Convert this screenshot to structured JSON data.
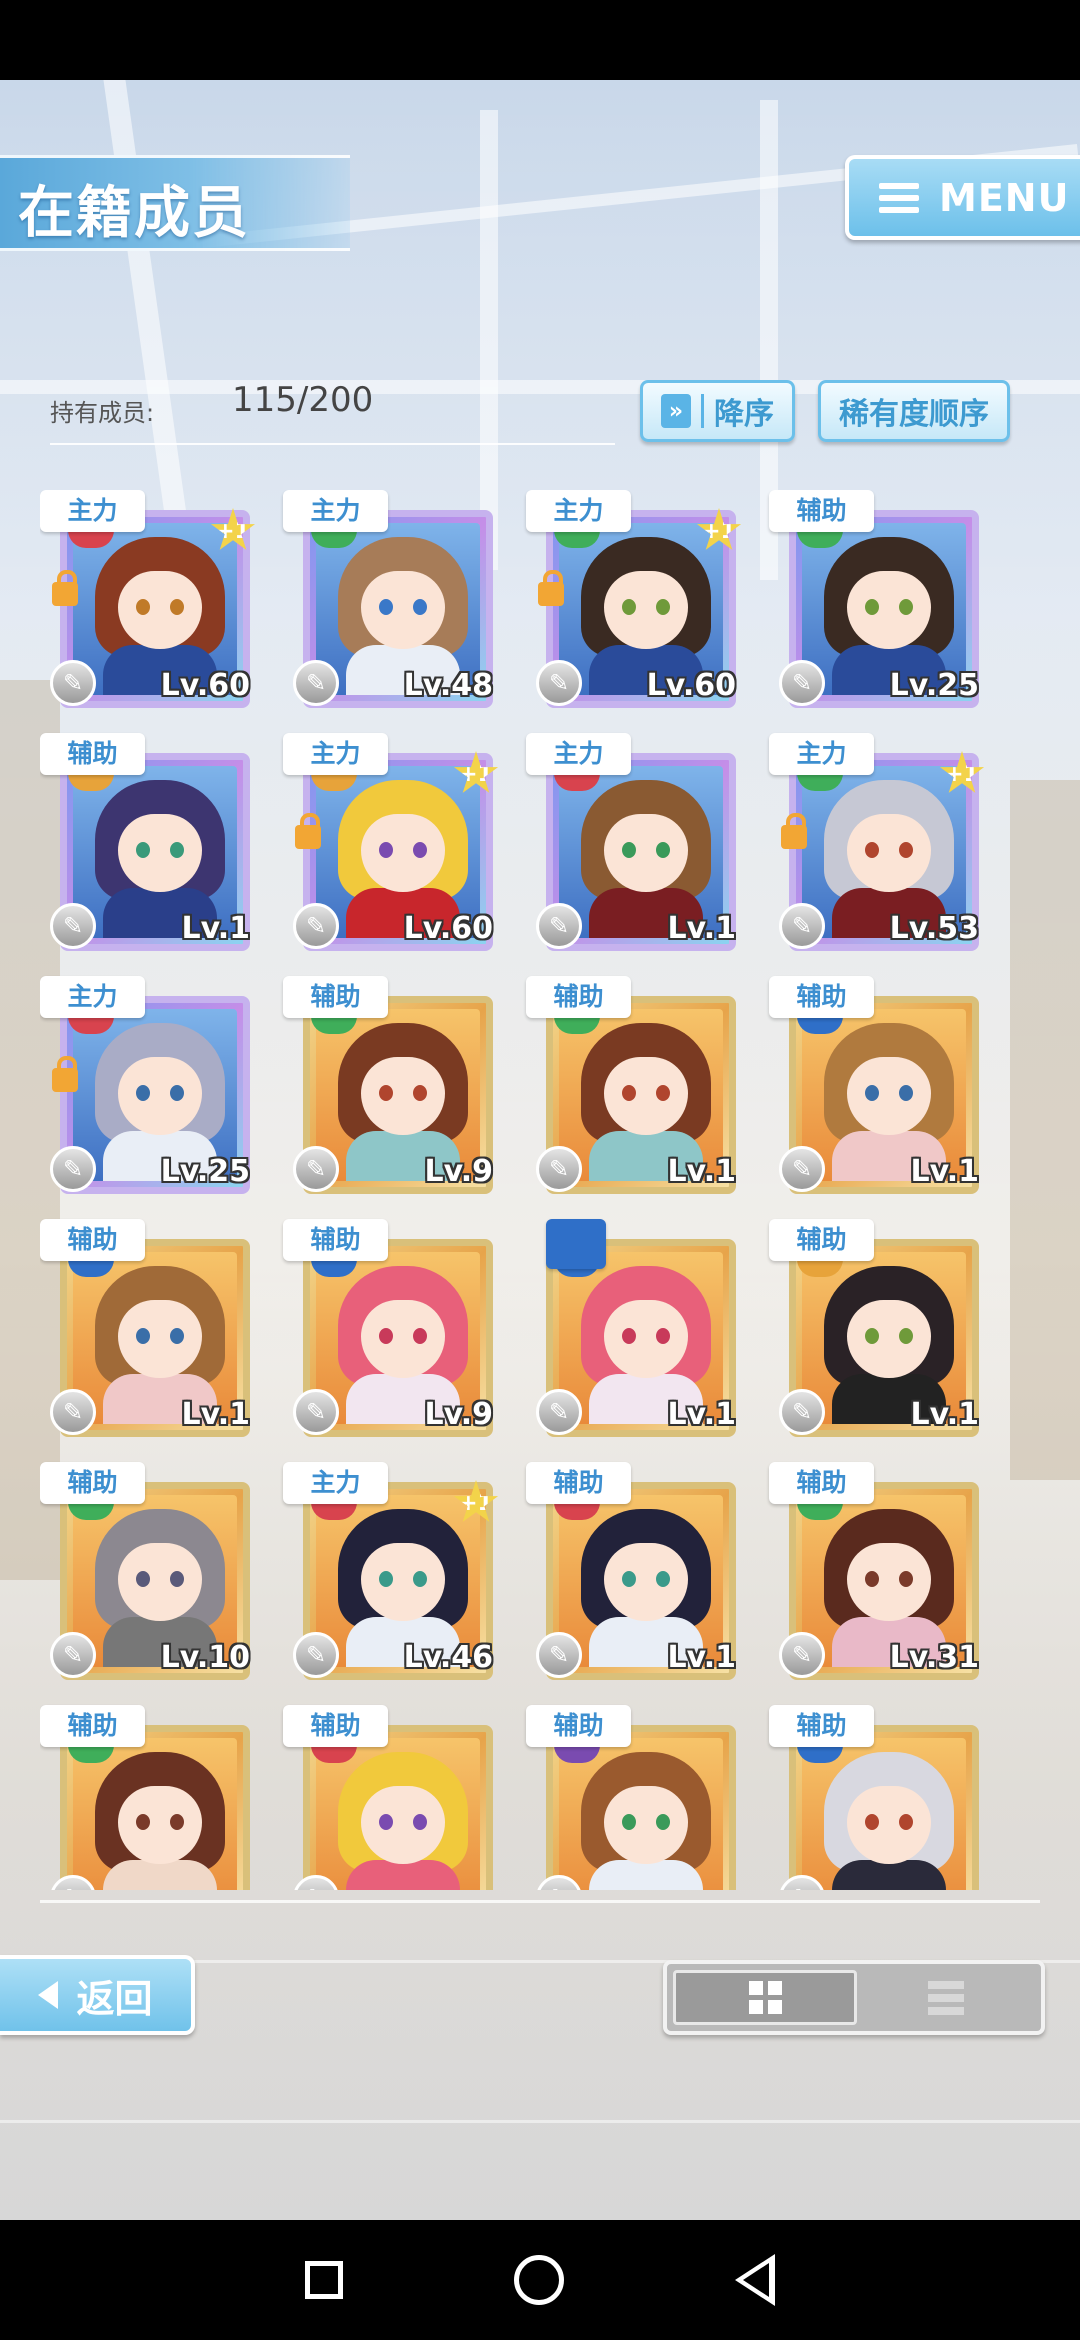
{
  "header": {
    "title": "在籍成员",
    "menu_label": "MENU",
    "member_label": "持有成员:",
    "member_count": "115/200",
    "sort_order_label": "降序",
    "sort_rarity_label": "稀有度顺序"
  },
  "cards": [
    {
      "role": "主力",
      "level": "Lv.60",
      "frame": "rainbow",
      "plus": "+1",
      "locked": true,
      "hair": "#8a3a22",
      "attr": "#d8434e",
      "eyes": "#c07a28",
      "outfit": "#2a4b9a"
    },
    {
      "role": "主力",
      "level": "Lv.48",
      "frame": "rainbow",
      "plus": "",
      "locked": false,
      "hair": "#a77c58",
      "attr": "#3fae5a",
      "eyes": "#3a78c8",
      "outfit": "#e9eef6"
    },
    {
      "role": "主力",
      "level": "Lv.60",
      "frame": "rainbow",
      "plus": "+1",
      "locked": true,
      "hair": "#3a2a22",
      "attr": "#3fae5a",
      "eyes": "#6f9a3a",
      "outfit": "#2a4b9a"
    },
    {
      "role": "辅助",
      "level": "Lv.25",
      "frame": "rainbow",
      "plus": "",
      "locked": false,
      "hair": "#3a2a22",
      "attr": "#3fae5a",
      "eyes": "#6f9a3a",
      "outfit": "#2a4b9a"
    },
    {
      "role": "辅助",
      "level": "Lv.1",
      "frame": "rainbow",
      "plus": "",
      "locked": false,
      "hair": "#3d3570",
      "attr": "#e7a33a",
      "eyes": "#3a9a7a",
      "outfit": "#2a3f8a"
    },
    {
      "role": "主力",
      "level": "Lv.60",
      "frame": "rainbow",
      "plus": "+1",
      "locked": true,
      "hair": "#f1c93c",
      "attr": "#e7a33a",
      "eyes": "#7a4bb0",
      "outfit": "#c8262c"
    },
    {
      "role": "主力",
      "level": "Lv.1",
      "frame": "rainbow",
      "plus": "",
      "locked": false,
      "hair": "#8a5a32",
      "attr": "#d8434e",
      "eyes": "#3a9a5a",
      "outfit": "#7a1e22"
    },
    {
      "role": "主力",
      "level": "Lv.53",
      "frame": "rainbow",
      "plus": "+1",
      "locked": true,
      "hair": "#c6c8d4",
      "attr": "#3fae5a",
      "eyes": "#b0452e",
      "outfit": "#7a1e22"
    },
    {
      "role": "主力",
      "level": "Lv.25",
      "frame": "rainbow",
      "plus": "",
      "locked": true,
      "hair": "#a9acc6",
      "attr": "#d8434e",
      "eyes": "#3a6ea8",
      "outfit": "#e9eef6"
    },
    {
      "role": "辅助",
      "level": "Lv.9",
      "frame": "gold",
      "plus": "",
      "locked": false,
      "hair": "#7a3a22",
      "attr": "#3fae5a",
      "eyes": "#b0452e",
      "outfit": "#8ec6c8"
    },
    {
      "role": "辅助",
      "level": "Lv.1",
      "frame": "gold",
      "plus": "",
      "locked": false,
      "hair": "#7a3a22",
      "attr": "#3fae5a",
      "eyes": "#b0452e",
      "outfit": "#8ec6c8"
    },
    {
      "role": "辅助",
      "level": "Lv.1",
      "frame": "gold",
      "plus": "",
      "locked": false,
      "hair": "#b07a3e",
      "attr": "#2f6fc8",
      "eyes": "#3a6ea8",
      "outfit": "#f0c8c8"
    },
    {
      "role": "辅助",
      "level": "Lv.1",
      "frame": "gold",
      "plus": "",
      "locked": false,
      "hair": "#a06a38",
      "attr": "#2f6fc8",
      "eyes": "#3a6ea8",
      "outfit": "#f0c8c8"
    },
    {
      "role": "辅助",
      "level": "Lv.9",
      "frame": "gold",
      "plus": "",
      "locked": false,
      "hair": "#e8607a",
      "attr": "#2f6fc8",
      "eyes": "#c83a5a",
      "outfit": "#f2e6f0"
    },
    {
      "role": "",
      "level": "Lv.1",
      "frame": "gold",
      "plus": "",
      "locked": false,
      "hair": "#e8607a",
      "attr": "#2f6fc8",
      "eyes": "#c83a5a",
      "outfit": "#f2e6f0"
    },
    {
      "role": "辅助",
      "level": "Lv.1",
      "frame": "gold",
      "plus": "",
      "locked": false,
      "hair": "#2a2226",
      "attr": "#e7a33a",
      "eyes": "#6f9a3a",
      "outfit": "#222222"
    },
    {
      "role": "辅助",
      "level": "Lv.10",
      "frame": "gold",
      "plus": "",
      "locked": false,
      "hair": "#8c8890",
      "attr": "#3fae5a",
      "eyes": "#5a5a7a",
      "outfit": "#777777"
    },
    {
      "role": "主力",
      "level": "Lv.46",
      "frame": "gold",
      "plus": "+1",
      "locked": false,
      "hair": "#22223a",
      "attr": "#d8434e",
      "eyes": "#3a9a8a",
      "outfit": "#e9eef6"
    },
    {
      "role": "辅助",
      "level": "Lv.1",
      "frame": "gold",
      "plus": "",
      "locked": false,
      "hair": "#22223a",
      "attr": "#d8434e",
      "eyes": "#3a9a8a",
      "outfit": "#e9eef6"
    },
    {
      "role": "辅助",
      "level": "Lv.31",
      "frame": "gold",
      "plus": "",
      "locked": false,
      "hair": "#5a2a1e",
      "attr": "#3fae5a",
      "eyes": "#7a3a2a",
      "outfit": "#e9b9c8"
    },
    {
      "role": "辅助",
      "level": "",
      "frame": "gold",
      "plus": "",
      "locked": false,
      "hair": "#6a3222",
      "attr": "#3fae5a",
      "eyes": "#7a3a2a",
      "outfit": "#f0d8c8"
    },
    {
      "role": "辅助",
      "level": "",
      "frame": "gold",
      "plus": "",
      "locked": false,
      "hair": "#f1c93c",
      "attr": "#d8434e",
      "eyes": "#7a4bb0",
      "outfit": "#e8607a"
    },
    {
      "role": "辅助",
      "level": "",
      "frame": "gold",
      "plus": "",
      "locked": false,
      "hair": "#9a5a2e",
      "attr": "#7a4bb0",
      "eyes": "#3a9a5a",
      "outfit": "#e9eef6"
    },
    {
      "role": "辅助",
      "level": "",
      "frame": "gold",
      "plus": "",
      "locked": false,
      "hair": "#d8d8e0",
      "attr": "#2f6fc8",
      "eyes": "#b0452e",
      "outfit": "#2a2a3a"
    }
  ],
  "footer": {
    "back_label": "返回"
  }
}
